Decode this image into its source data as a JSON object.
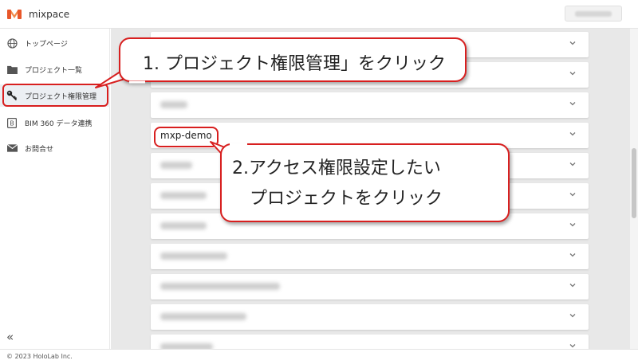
{
  "header": {
    "app_name": "mixpace"
  },
  "sidebar": {
    "items": [
      {
        "label": "トップページ",
        "icon": "globe-icon"
      },
      {
        "label": "プロジェクト一覧",
        "icon": "folder-icon"
      },
      {
        "label": "プロジェクト権限管理",
        "icon": "key-icon"
      },
      {
        "label": "BIM 360 データ連携",
        "icon": "bim-icon"
      },
      {
        "label": "お問合せ",
        "icon": "mail-icon"
      }
    ],
    "collapse_label": "«"
  },
  "projects": [
    {
      "label": ""
    },
    {
      "label": ""
    },
    {
      "label": ""
    },
    {
      "label": "mxp-demo"
    },
    {
      "label": ""
    },
    {
      "label": ""
    },
    {
      "label": ""
    },
    {
      "label": ""
    },
    {
      "label": ""
    },
    {
      "label": ""
    },
    {
      "label": ""
    }
  ],
  "annotations": {
    "step1": "1. プロジェクト権限管理」をクリック",
    "step2": "2.アクセス権限設定したい\n　プロジェクトをクリック"
  },
  "footer": {
    "copyright": "© 2023 HoloLab Inc."
  },
  "colors": {
    "accent_red": "#d81f1f",
    "logo_orange": "#e8572a"
  }
}
